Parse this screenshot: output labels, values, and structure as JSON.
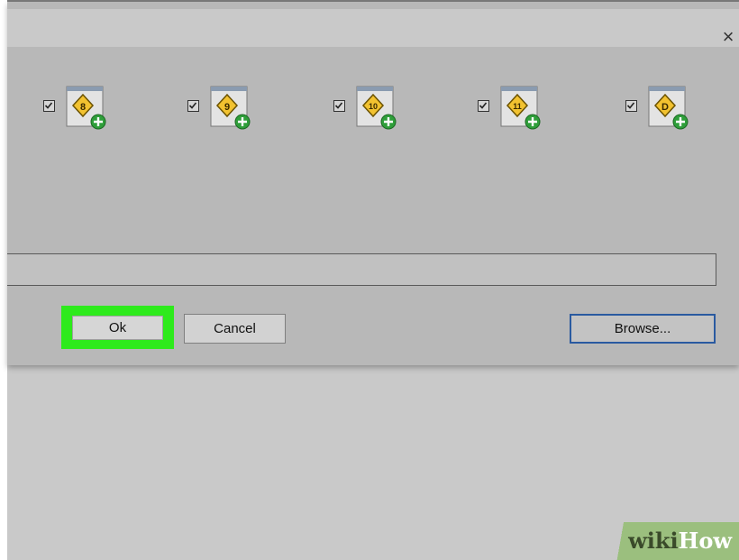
{
  "dialog": {
    "close_glyph": "×",
    "icons": [
      {
        "label": "8",
        "checked": true
      },
      {
        "label": "9",
        "checked": true
      },
      {
        "label": "10",
        "checked": true
      },
      {
        "label": "11",
        "checked": true
      },
      {
        "label": "D",
        "checked": true
      }
    ],
    "path_field": {
      "value": ""
    },
    "buttons": {
      "ok": "Ok",
      "cancel": "Cancel",
      "browse": "Browse..."
    },
    "highlight_color": "#2eea1c"
  },
  "watermark": {
    "part1": "wiki",
    "part2": "How"
  }
}
